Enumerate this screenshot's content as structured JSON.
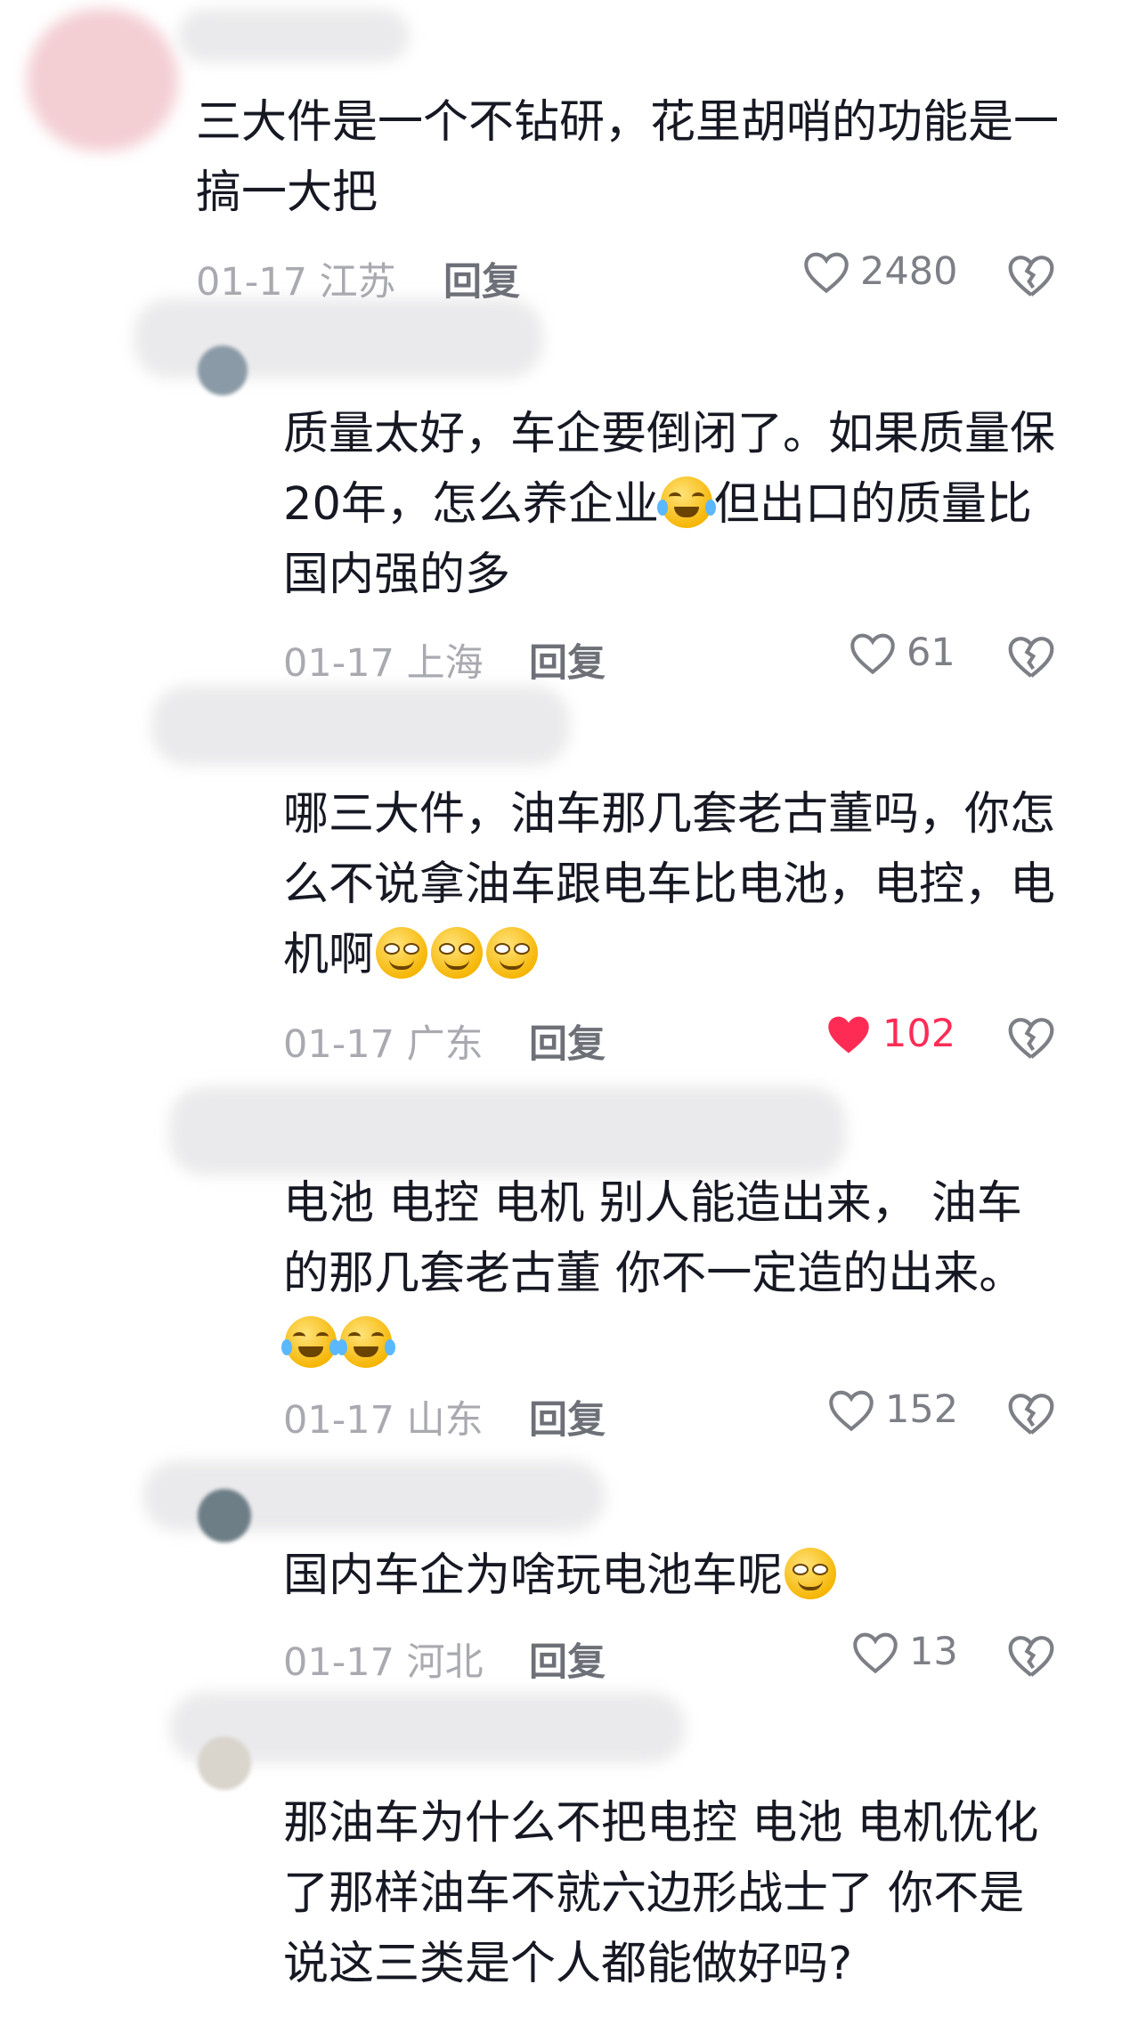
{
  "comments": [
    {
      "text": "三大件是一个不钻研，花里胡哨的功能是一搞一大把",
      "date_region": "01-17 江苏",
      "reply_label": "回复",
      "likes": "2480",
      "liked": false
    },
    {
      "text_parts": [
        "质量太好，车企要倒闭了。如果质量保20年，怎么养企业",
        "但出口的质量比国内强的多"
      ],
      "date_region": "01-17 上海",
      "reply_label": "回复",
      "likes": "61",
      "liked": false
    },
    {
      "text": "哪三大件，油车那几套老古董吗，你怎么不说拿油车跟电车比电池，电控，电机啊",
      "date_region": "01-17 广东",
      "reply_label": "回复",
      "likes": "102",
      "liked": true
    },
    {
      "text": "电池 电控 电机 别人能造出来， 油车的那几套老古董 你不一定造的出来。",
      "date_region": "01-17 山东",
      "reply_label": "回复",
      "likes": "152",
      "liked": false
    },
    {
      "text": "国内车企为啥玩电池车呢",
      "date_region": "01-17 河北",
      "reply_label": "回复",
      "likes": "13",
      "liked": false
    },
    {
      "text": "那油车为什么不把电控 电池 电机优化了那样油车不就六边形战士了 你不是说这三类是个人都能做好吗?"
    }
  ],
  "colors": {
    "like_active": "#fe2c55",
    "meta": "#a9aab0",
    "text": "#161823"
  },
  "icons": {
    "like": "heart-outline-icon",
    "like_active": "heart-filled-icon",
    "dislike": "broken-heart-icon"
  }
}
